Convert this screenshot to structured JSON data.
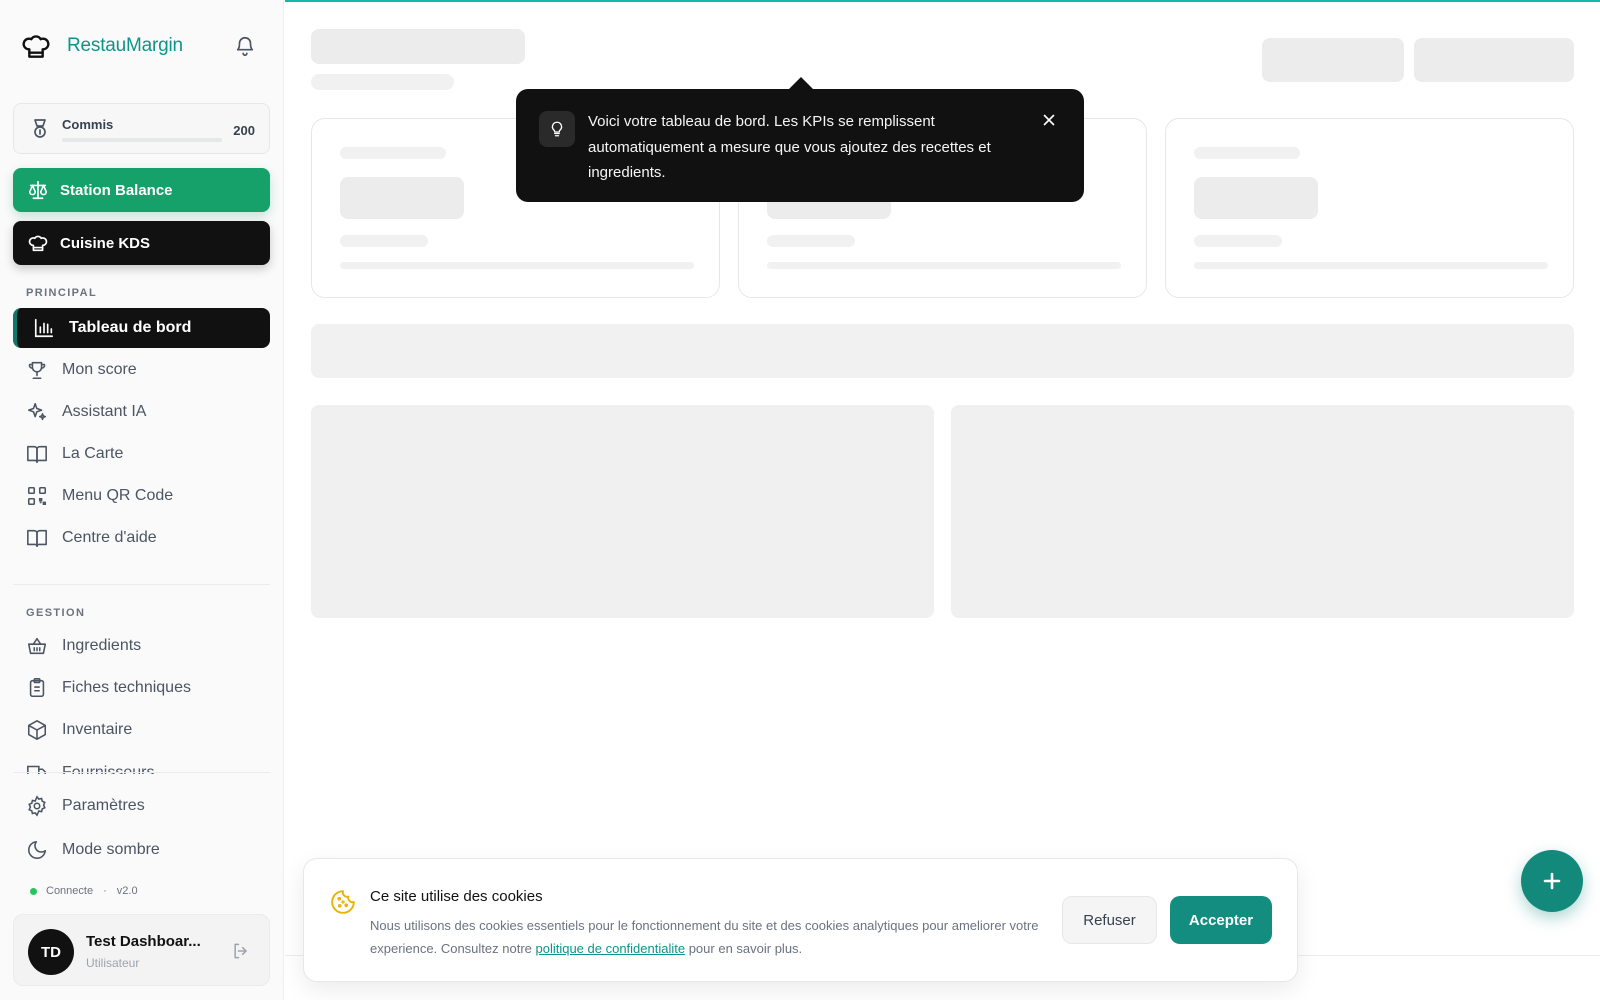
{
  "brand": {
    "name": "RestauMargin"
  },
  "level": {
    "name": "Commis",
    "points": "200"
  },
  "cta": {
    "station": "Station Balance",
    "kds": "Cuisine KDS"
  },
  "sections": {
    "principal": "PRINCIPAL",
    "gestion": "GESTION"
  },
  "nav": {
    "principal": [
      "Tableau de bord",
      "Mon score",
      "Assistant IA",
      "La Carte",
      "Menu QR Code",
      "Centre d'aide"
    ],
    "gestion": [
      "Ingredients",
      "Fiches techniques",
      "Inventaire",
      "Fournisseurs"
    ],
    "bottom": [
      "Paramètres",
      "Mode sombre"
    ]
  },
  "status": {
    "connection": "Connecte",
    "version": "v2.0"
  },
  "user": {
    "initials": "TD",
    "name": "Test Dashboar...",
    "role": "Utilisateur"
  },
  "tooltip": {
    "text": "Voici votre tableau de bord. Les KPIs se remplissent automatiquement a mesure que vous ajoutez des recettes et ingredients."
  },
  "cookie": {
    "title": "Ce site utilise des cookies",
    "text_before": "Nous utilisons des cookies essentiels pour le fonctionnement du site et des cookies analytiques pour ameliorer votre experience. Consultez notre ",
    "link": "politique de confidentialite",
    "text_after": " pour en savoir plus.",
    "refuse": "Refuser",
    "accept": "Accepter"
  },
  "colors": {
    "accent": "#0f9488",
    "primary_green": "#16a06a",
    "dark": "#111111"
  }
}
